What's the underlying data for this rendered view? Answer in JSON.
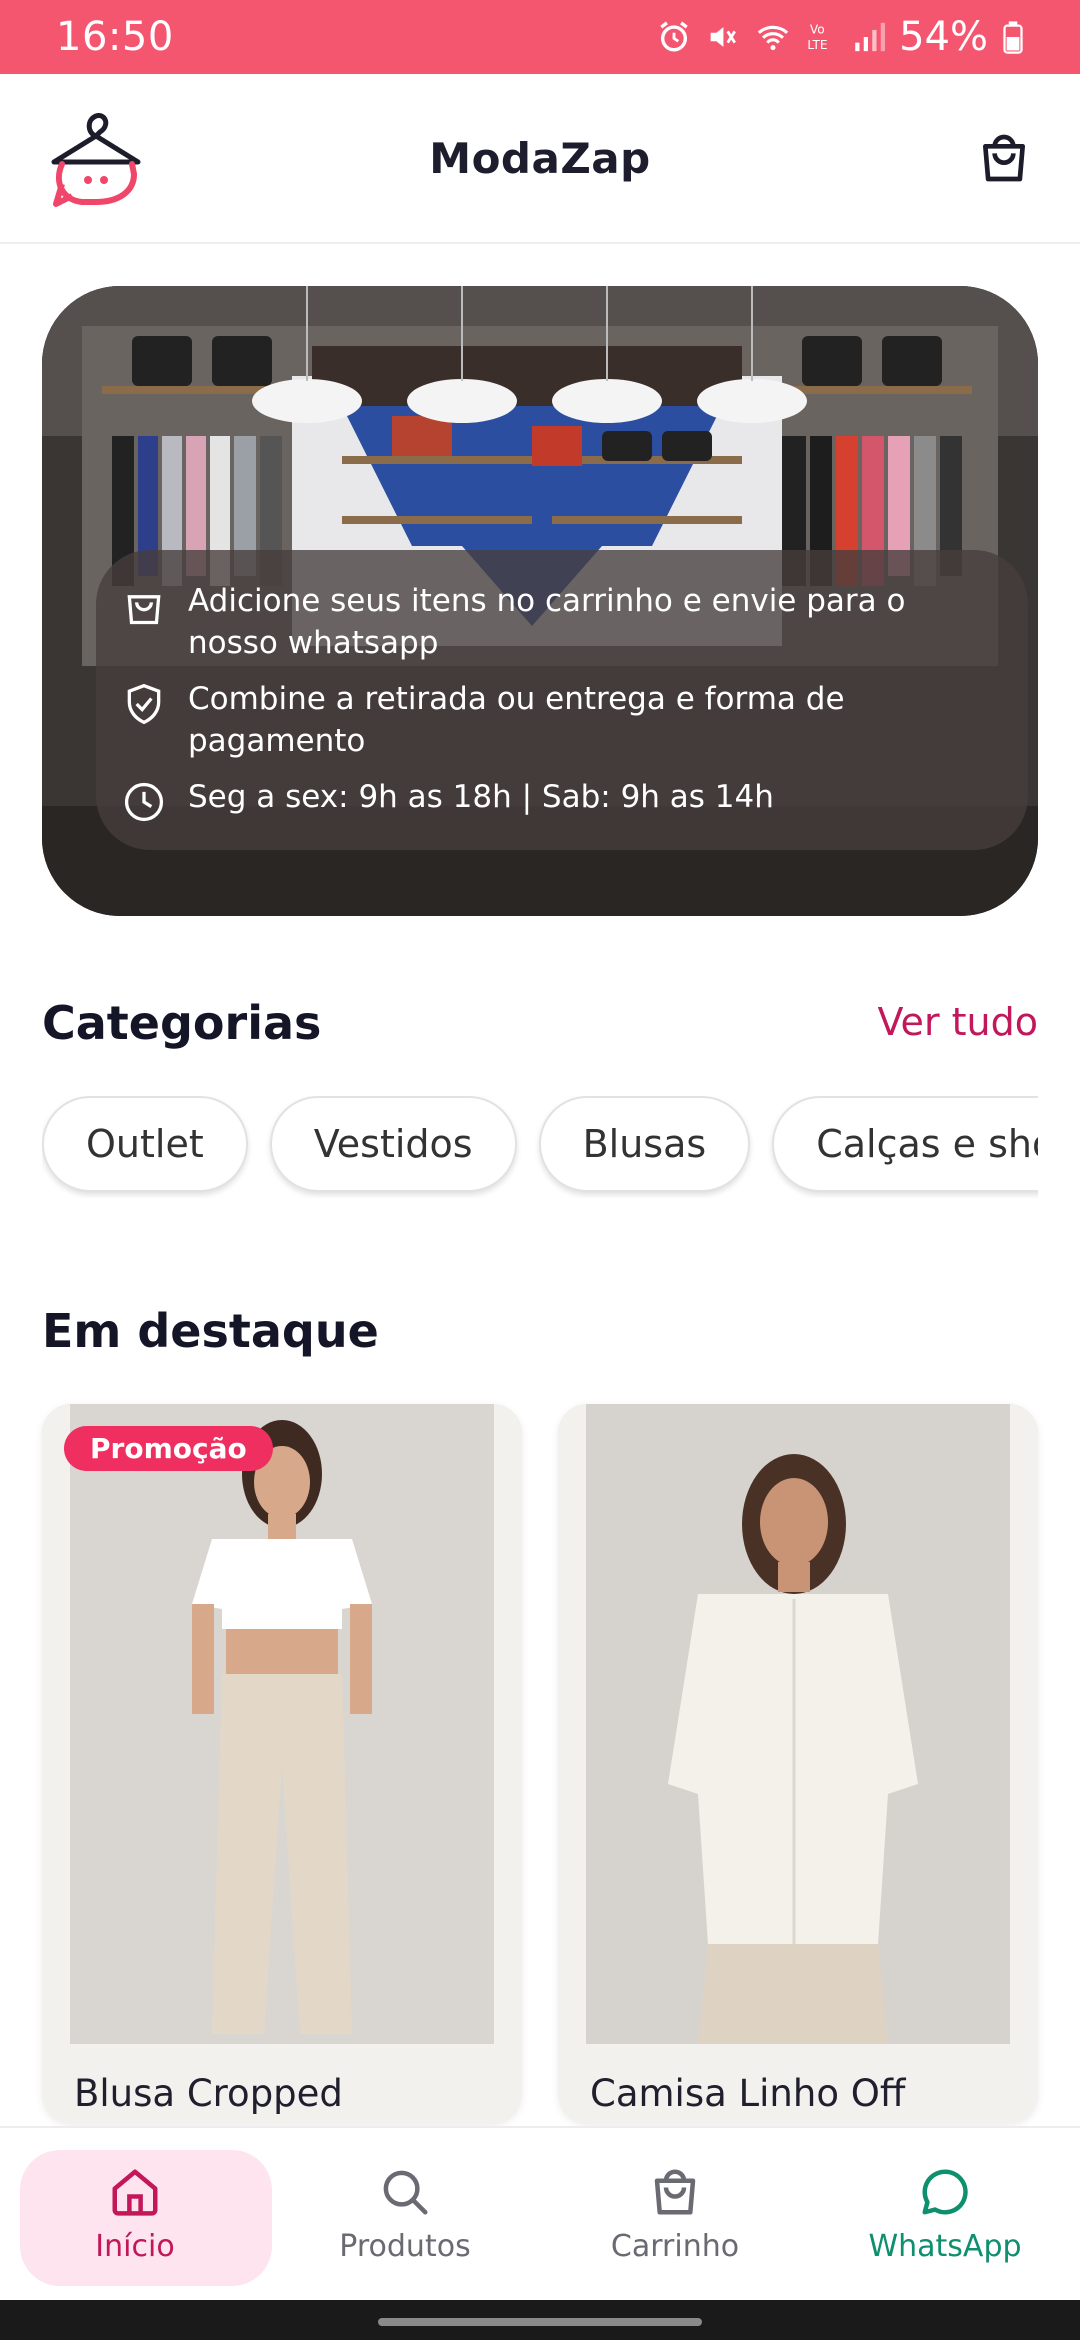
{
  "status_bar": {
    "time": "16:50",
    "battery": "54%"
  },
  "header": {
    "title": "ModaZap"
  },
  "hero": {
    "info": [
      {
        "icon": "bag-icon",
        "text": "Adicione seus itens no carrinho e envie para o nosso whatsapp"
      },
      {
        "icon": "shield-check-icon",
        "text": "Combine a retirada ou entrega e forma de pagamento"
      },
      {
        "icon": "clock-icon",
        "text": "Seg a sex: 9h as 18h | Sab: 9h as 14h"
      }
    ]
  },
  "categories": {
    "title": "Categorias",
    "see_all": "Ver tudo",
    "items": [
      "Outlet",
      "Vestidos",
      "Blusas",
      "Calças e shorts"
    ]
  },
  "featured": {
    "title": "Em destaque",
    "products": [
      {
        "name": "Blusa Cropped",
        "badge": "Promoção"
      },
      {
        "name": "Camisa Linho Off",
        "badge": ""
      }
    ]
  },
  "bottom_nav": {
    "items": [
      {
        "label": "Início",
        "icon": "home-icon"
      },
      {
        "label": "Produtos",
        "icon": "search-icon"
      },
      {
        "label": "Carrinho",
        "icon": "bag-icon"
      },
      {
        "label": "WhatsApp",
        "icon": "chat-icon"
      }
    ]
  },
  "colors": {
    "accent": "#c2185b",
    "status_bar": "#f5566f",
    "badge": "#ef2f5f",
    "whatsapp": "#0e8f6e"
  }
}
